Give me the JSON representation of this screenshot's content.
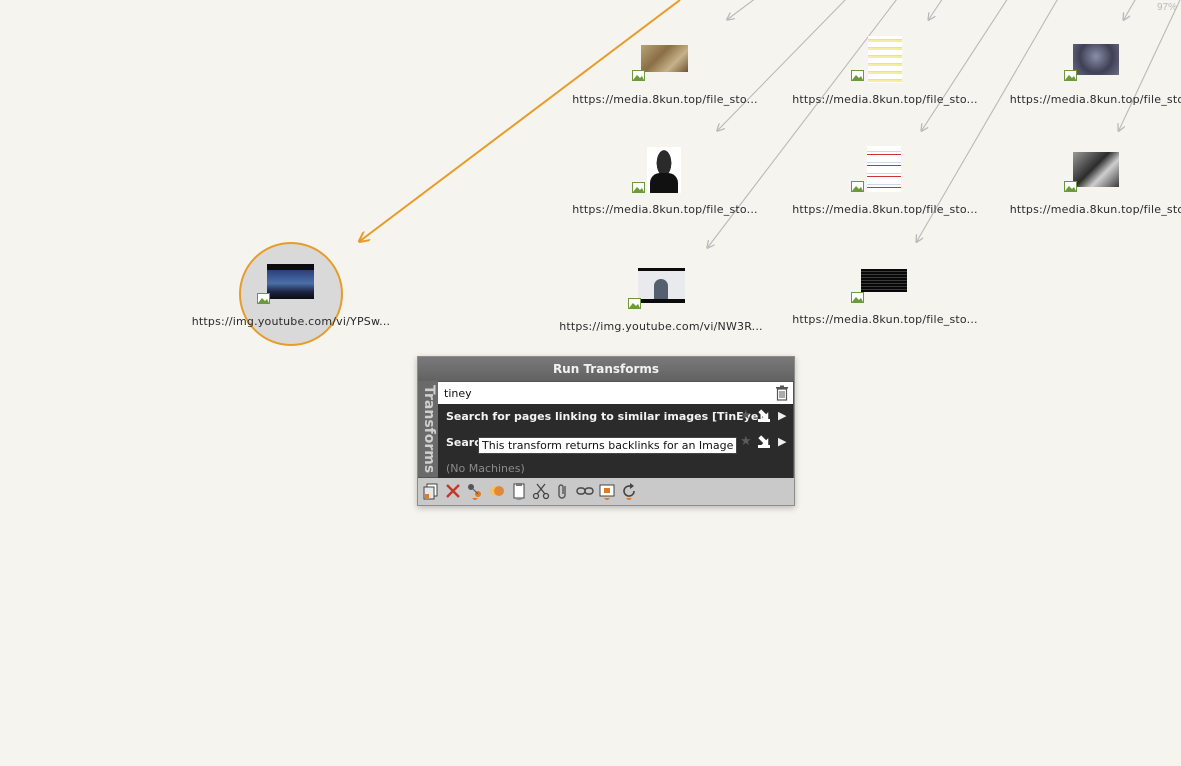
{
  "zoom": "97%",
  "graph": {
    "nodes": [
      {
        "id": "n1",
        "label": "https://media.8kun.top/file_sto...",
        "icon": "image-entity-icon",
        "thumb": "ornate-engraving"
      },
      {
        "id": "n2",
        "label": "https://media.8kun.top/file_sto...",
        "icon": "image-entity-icon",
        "thumb": "text-document"
      },
      {
        "id": "n3",
        "label": "https://media.8kun.top/file_sto",
        "icon": "image-entity-icon",
        "thumb": "sculpture"
      },
      {
        "id": "n4",
        "label": "https://media.8kun.top/file_sto...",
        "icon": "image-entity-icon",
        "thumb": "portrait"
      },
      {
        "id": "n5",
        "label": "https://media.8kun.top/file_sto...",
        "icon": "image-entity-icon",
        "thumb": "social-feed"
      },
      {
        "id": "n6",
        "label": "https://media.8kun.top/file_sto",
        "icon": "image-entity-icon",
        "thumb": "bw-photo"
      },
      {
        "id": "n7",
        "label": "https://img.youtube.com/vi/YPSw...",
        "icon": "image-entity-icon",
        "thumb": "video-still",
        "selected": true
      },
      {
        "id": "n8",
        "label": "https://img.youtube.com/vi/NW3R...",
        "icon": "image-entity-icon",
        "thumb": "speaker-video"
      },
      {
        "id": "n9",
        "label": "https://media.8kun.top/file_sto...",
        "icon": "image-entity-icon",
        "thumb": "dark-text"
      }
    ],
    "link_color": "#b9b9b9",
    "selected_link_color": "#e79c2a"
  },
  "run_transforms": {
    "title": "Run Transforms",
    "side_tab": "Transforms",
    "search_value": "tiney",
    "results": [
      {
        "label": "Search for pages linking to similar images [TinEye]"
      },
      {
        "label": "Search"
      }
    ],
    "no_machines": "(No Machines)",
    "tooltip": "This transform returns backlinks for an Image",
    "toolbar": [
      "copy-icon",
      "delete-icon",
      "select-branch-icon",
      "merge-icon",
      "paste-icon",
      "cut-icon",
      "attach-icon",
      "link-icon",
      "highlight-icon",
      "refresh-icon"
    ]
  }
}
